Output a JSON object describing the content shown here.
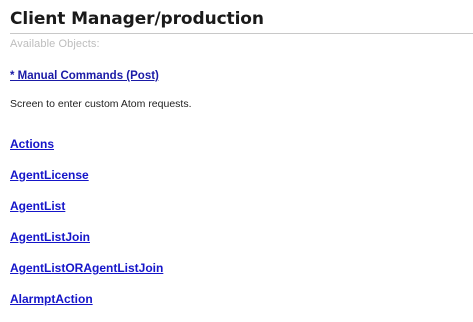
{
  "header": {
    "title": "Client Manager/production",
    "subtitle": "Available Objects:"
  },
  "manual": {
    "link_label": "* Manual Commands (Post)",
    "description": "Screen to enter custom Atom requests."
  },
  "objects": [
    {
      "label": "Actions"
    },
    {
      "label": "AgentLicense"
    },
    {
      "label": "AgentList"
    },
    {
      "label": "AgentListJoin"
    },
    {
      "label": "AgentListORAgentListJoin"
    },
    {
      "label": "AlarmptAction"
    }
  ],
  "colors": {
    "link": "#1515c9",
    "title": "#1a1a1a",
    "subtitle": "#bdbdbd"
  }
}
